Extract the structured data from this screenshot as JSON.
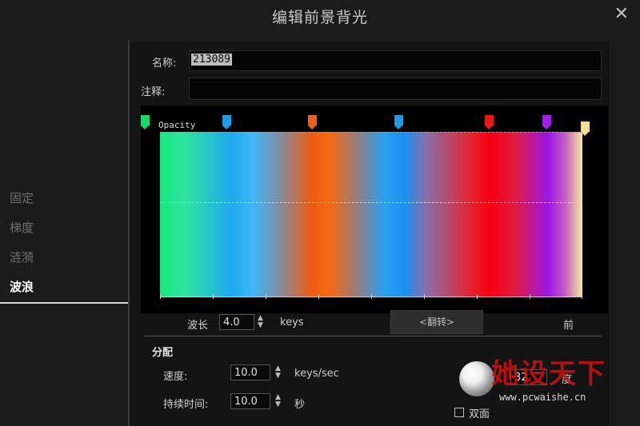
{
  "window": {
    "title": "编辑前景背光"
  },
  "sidebar": {
    "items": [
      {
        "label": "固定"
      },
      {
        "label": "梯度"
      },
      {
        "label": "涟漪"
      },
      {
        "label": "波浪"
      }
    ]
  },
  "form": {
    "name_label": "名称:",
    "name_value": "213089",
    "note_label": "注释:",
    "note_value": ""
  },
  "gradient": {
    "opacity_label": "Opacity",
    "markers": [
      {
        "color": "#16d96a"
      },
      {
        "color": "#1e9be8"
      },
      {
        "color": "#f06018"
      },
      {
        "color": "#1e9be8"
      },
      {
        "color": "#e81818"
      },
      {
        "color": "#a020e8"
      },
      {
        "color": "#f0e090"
      }
    ]
  },
  "wave": {
    "wavelength_label": "波长",
    "wavelength_value": "4.0",
    "wavelength_unit": "keys",
    "flip_label": "<翻转>",
    "direction_label": "前"
  },
  "distribution": {
    "section_title": "分配",
    "speed_label": "速度:",
    "speed_value": "10.0",
    "speed_unit": "keys/sec",
    "duration_label": "持续时间:",
    "duration_value": "10.0",
    "duration_unit": "秒",
    "count_value": "32",
    "count_suffix": "度",
    "double_sided_label": "双面"
  },
  "watermark": {
    "text": "她设天下",
    "url": "www.pcwaishe.cn"
  }
}
